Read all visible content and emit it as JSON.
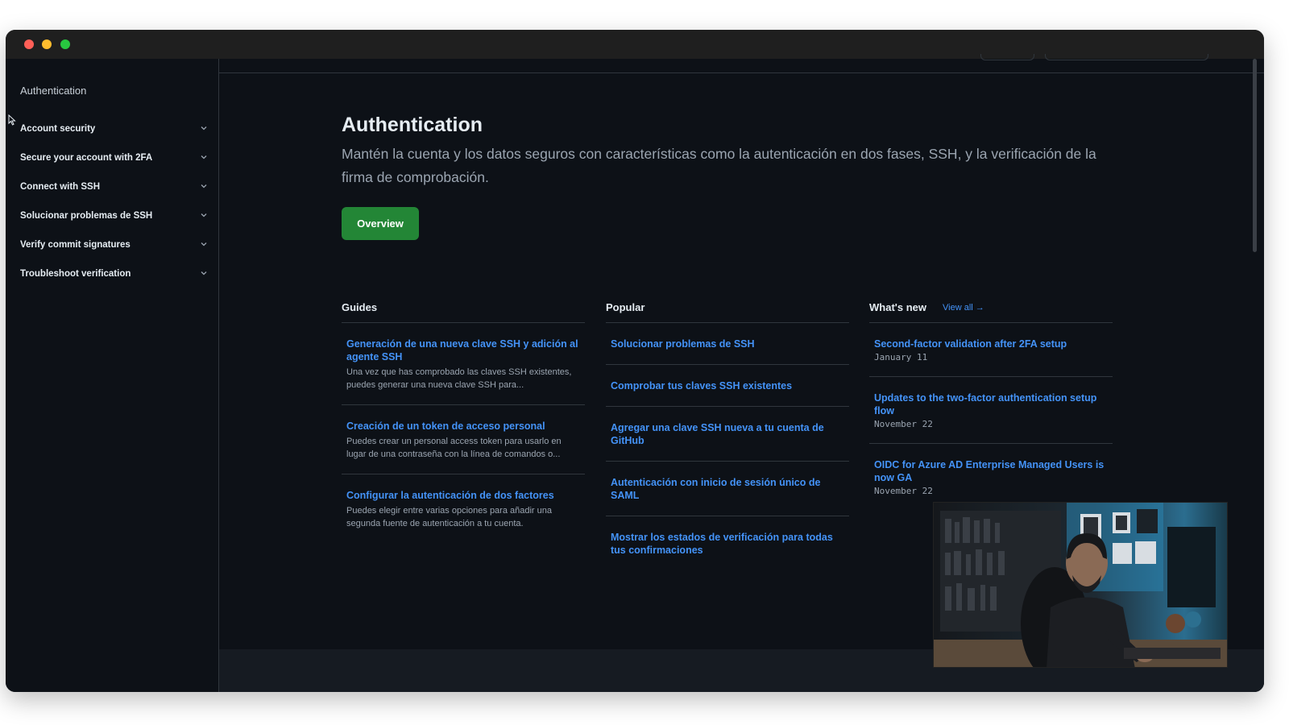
{
  "sidebar": {
    "heading": "Authentication",
    "items": [
      {
        "label": "Account security"
      },
      {
        "label": "Secure your account with 2FA"
      },
      {
        "label": "Connect with SSH"
      },
      {
        "label": "Solucionar problemas de SSH"
      },
      {
        "label": "Verify commit signatures"
      },
      {
        "label": "Troubleshoot verification"
      }
    ]
  },
  "main": {
    "title": "Authentication",
    "intro": "Mantén la cuenta y los datos seguros con características como la autenticación en dos fases, SSH, y la verificación de la firma de comprobación.",
    "overview_label": "Overview"
  },
  "guides": {
    "header": "Guides",
    "items": [
      {
        "title": "Generación de una nueva clave SSH y adición al agente SSH",
        "desc": "Una vez que has comprobado las claves SSH existentes, puedes generar una nueva clave SSH para..."
      },
      {
        "title": "Creación de un token de acceso personal",
        "desc": "Puedes crear un personal access token para usarlo en lugar de una contraseña con la línea de comandos o..."
      },
      {
        "title": "Configurar la autenticación de dos factores",
        "desc": "Puedes elegir entre varias opciones para añadir una segunda fuente de autenticación a tu cuenta."
      }
    ]
  },
  "popular": {
    "header": "Popular",
    "items": [
      {
        "title": "Solucionar problemas de SSH"
      },
      {
        "title": "Comprobar tus claves SSH existentes"
      },
      {
        "title": "Agregar una clave SSH nueva a tu cuenta de GitHub"
      },
      {
        "title": "Autenticación con inicio de sesión único de SAML"
      },
      {
        "title": "Mostrar los estados de verificación para todas tus confirmaciones"
      }
    ]
  },
  "news": {
    "header": "What's new",
    "view_all": "View all →",
    "items": [
      {
        "title": "Second-factor validation after 2FA setup",
        "date": "January 11"
      },
      {
        "title": "Updates to the two-factor authentication setup flow",
        "date": "November 22"
      },
      {
        "title": "OIDC for Azure AD Enterprise Managed Users is now GA",
        "date": "November 22"
      }
    ]
  },
  "colors": {
    "background": "#0d1117",
    "link": "#4493f8",
    "button": "#238636",
    "border": "#30363d"
  },
  "icons": {
    "chevron": "chevron-down-icon",
    "cursor": "mouse-pointer-icon"
  }
}
